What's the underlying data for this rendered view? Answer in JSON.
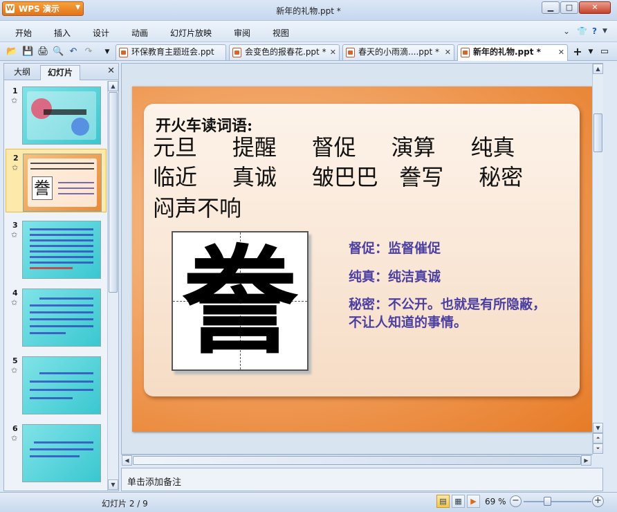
{
  "app": {
    "name": "WPS 演示",
    "window_title": "新年的礼物.ppt *"
  },
  "menu": [
    "开始",
    "插入",
    "设计",
    "动画",
    "幻灯片放映",
    "审阅",
    "视图"
  ],
  "document_tabs": [
    {
      "label": "环保教育主题班会.ppt",
      "active": false
    },
    {
      "label": "会变色的报春花.ppt *",
      "active": false
    },
    {
      "label": "春天的小雨滴....ppt *",
      "active": false
    },
    {
      "label": "新年的礼物.ppt *",
      "active": true
    }
  ],
  "left_panel": {
    "tabs": [
      "大纲",
      "幻灯片"
    ],
    "active_tab": "幻灯片",
    "thumbnails": [
      {
        "number": "1",
        "selected": false
      },
      {
        "number": "2",
        "selected": true
      },
      {
        "number": "3",
        "selected": false
      },
      {
        "number": "4",
        "selected": false
      },
      {
        "number": "5",
        "selected": false
      },
      {
        "number": "6",
        "selected": false
      }
    ]
  },
  "slide": {
    "heading": "开火车读词语:",
    "word_lines": [
      "元旦     提醒     督促     演算     纯真",
      "临近     真诚     皱巴巴   誊写     秘密",
      "闷声不响"
    ],
    "character": "誊",
    "definitions": [
      "督促：监督催促",
      "纯真：纯洁真诚",
      "秘密：不公开。也就是有所隐蔽，不让人知道的事情。"
    ]
  },
  "notes": {
    "placeholder": "单击添加备注"
  },
  "status": {
    "slide_indicator": "幻灯片 2 / 9",
    "zoom": "69 %",
    "zoom_value": 69
  },
  "colors": {
    "accent": "#e2731a",
    "definition_text": "#4b3fa2",
    "selection": "#fde9a9"
  }
}
